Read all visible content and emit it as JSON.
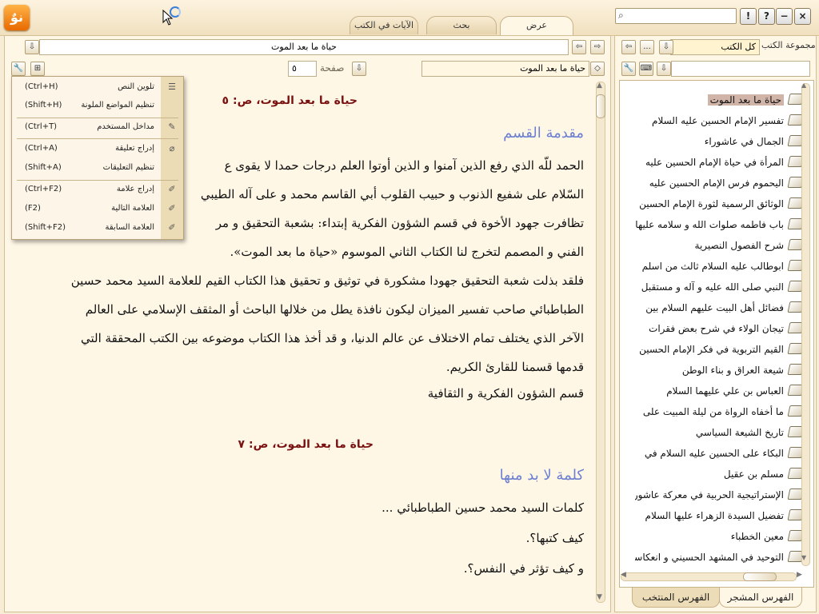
{
  "app": {
    "logo_text": "نوٌ"
  },
  "tabs": [
    {
      "label": "الآيات في الكتب"
    },
    {
      "label": "بحث"
    },
    {
      "label": "عرض"
    }
  ],
  "window": {
    "help_label": "?",
    "info_label": "!",
    "minimize_label": "−",
    "close_label": "×"
  },
  "search": {
    "value": "",
    "placeholder": ""
  },
  "viewer": {
    "book_title_value": "حياة ما بعد الموت",
    "book_select_value": "حياة ما بعد الموت",
    "page_label": "صفحة",
    "page_value": "٥"
  },
  "context_menu": {
    "items": [
      {
        "label": "تلوين النص",
        "shortcut": "(Ctrl+H)",
        "icon": "highlight-text-icon"
      },
      {
        "label": "تنظيم المواضع الملونة",
        "shortcut": "(Shift+H)",
        "icon": "organize-highlights-icon"
      },
      {
        "label": "مداخل المستخدم",
        "shortcut": "(Ctrl+T)",
        "icon": "user-entries-icon"
      },
      {
        "label": "إدراج تعليقة",
        "shortcut": "(Ctrl+A)",
        "icon": "comment-icon"
      },
      {
        "label": "تنظيم التعليقات",
        "shortcut": "(Shift+A)",
        "icon": "organize-comments-icon"
      },
      {
        "label": "إدراج علامة",
        "shortcut": "(Ctrl+F2)",
        "icon": "bookmark-insert-icon"
      },
      {
        "label": "العلامة التالية",
        "shortcut": "(F2)",
        "icon": "bookmark-next-icon"
      },
      {
        "label": "العلامة السابقة",
        "shortcut": "(Shift+F2)",
        "icon": "bookmark-prev-icon"
      }
    ]
  },
  "content": {
    "page_head_1": "حياة ما بعد الموت، ص: ٥",
    "section_1": "مقدمة القسم",
    "paragraph_1_lines": [
      "الحمد للّه الذي رفع الذين آمنوا و الذين أوتوا العلم درجات حمدا لا يقوى ع",
      "السّلام على شفيع الذنوب و حبيب القلوب أبي القاسم محمد و على آله الطيبي",
      "تظافرت جهود الأخوة في قسم الشؤون الفكرية إبتداء: بشعبة التحقيق و مر",
      "الفني و المصمم لتخرج لنا الكتاب الثاني الموسوم «حياة ما بعد الموت»."
    ],
    "paragraph_2_lines": [
      "فلقد بذلت شعبة التحقيق جهودا مشكورة في توثيق و تحقيق هذا الكتاب القيم للعلامة السيد محمد حسين",
      "الطباطبائي صاحب تفسير الميزان ليكون نافذة يطل من خلالها الباحث أو المثقف الإسلامي على العالم",
      "الآخر الذي يختلف تمام الاختلاف عن عالم الدنيا، و قد أخذ هذا الكتاب موضوعه بين الكتب المحققة التي",
      "قدمها قسمنا للقارئ الكريم."
    ],
    "signature": "قسم الشؤون الفكرية و الثقافية",
    "page_head_2": "حياة ما بعد الموت، ص: ٧",
    "section_2": "كلمة لا بد منها",
    "lines_3": [
      "كلمات السيد محمد حسين الطباطبائي ...",
      "كيف كتبها؟.",
      "و كيف تؤثر في النفس؟."
    ]
  },
  "right_panel": {
    "collection_label": "مجموعة الكتب",
    "collection_value": "كل الكتب",
    "more_label": "...",
    "filter_value": "",
    "books": [
      "حياة ما بعد الموت",
      "تفسير الإمام الحسين عليه السلام",
      "الجمال في عاشوراء",
      "المرأة في حياة الإمام الحسين عليه",
      "اليحموم فرس الإمام الحسين عليه",
      "الوثائق الرسمية لثورة الإمام الحسين",
      "باب فاطمه صلوات الله و سلامه عليها",
      "شرح الفصول النصيرية",
      "ابوطالب عليه السلام ثالث من اسلم",
      "النبي صلى الله عليه و آله و مستقبل",
      "فضائل أهل البيت عليهم السلام بين",
      "تيجان الولاء في شرح بعض فقرات",
      "القيم التربوية في فكر الإمام الحسين",
      "شيعة العراق و بناء الوطن",
      "العباس بن علي عليهما السلام",
      "ما أخفاه الرواة من ليلة المبيت على",
      "تاريخ الشيعة السياسي",
      "البكاء على الحسين عليه السلام في",
      "مسلم بن عقيل",
      "الإستراتيجية الحربية في معركة عاشوراء",
      "تفضيل السيدة الزهراء عليها السلام",
      "معين الخطباء",
      "التوحيد في المشهد الحسيني و انعكاسه"
    ],
    "selected_index": 0,
    "bottom_tabs": [
      {
        "label": "الفهرس المشجر"
      },
      {
        "label": "الفهرس المنتخب"
      }
    ]
  }
}
